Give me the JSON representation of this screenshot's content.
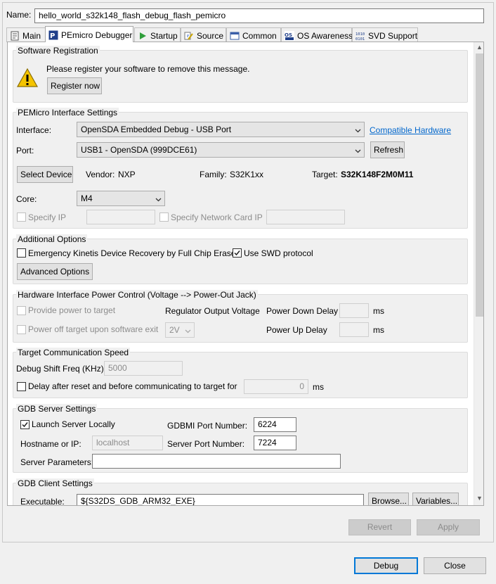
{
  "name_label": "Name:",
  "name_value": "hello_world_s32k148_flash_debug_flash_pemicro",
  "tabs": [
    {
      "label": "Main",
      "icon": "main-tab-icon"
    },
    {
      "label": "PEmicro Debugger",
      "icon": "pemicro-icon"
    },
    {
      "label": "Startup",
      "icon": "play-icon"
    },
    {
      "label": "Source",
      "icon": "source-icon"
    },
    {
      "label": "Common",
      "icon": "common-icon"
    },
    {
      "label": "OS Awareness",
      "icon": "os-icon"
    },
    {
      "label": "SVD Support",
      "icon": "svd-icon"
    }
  ],
  "registration": {
    "title": "Software Registration",
    "message": "Please register your software to remove this message.",
    "register_button": "Register now"
  },
  "interface_settings": {
    "title": "PEMicro Interface Settings",
    "interface_label": "Interface:",
    "interface_value": "OpenSDA Embedded Debug - USB Port",
    "compatible_link": "Compatible Hardware",
    "port_label": "Port:",
    "port_value": "USB1 - OpenSDA (999DCE61)",
    "refresh_button": "Refresh",
    "select_device_button": "Select Device",
    "vendor_label": "Vendor:",
    "vendor_value": "NXP",
    "family_label": "Family:",
    "family_value": "S32K1xx",
    "target_label": "Target:",
    "target_value": "S32K148F2M0M11",
    "core_label": "Core:",
    "core_value": "M4",
    "specify_ip_label": "Specify IP",
    "specify_ip_checked": false,
    "specify_nic_label": "Specify Network Card IP",
    "specify_nic_checked": false
  },
  "additional_options": {
    "title": "Additional Options",
    "emergency_label": "Emergency Kinetis Device Recovery by Full Chip Erase",
    "emergency_checked": false,
    "swd_label": "Use SWD protocol",
    "swd_checked": true,
    "advanced_button": "Advanced Options"
  },
  "power_control": {
    "title": "Hardware Interface Power Control (Voltage --> Power-Out Jack)",
    "provide_power_label": "Provide power to target",
    "provide_power_checked": false,
    "regulator_label": "Regulator Output Voltage",
    "power_down_label": "Power Down Delay",
    "power_down_unit": "ms",
    "power_off_label": "Power off target upon software exit",
    "power_off_checked": false,
    "voltage_value": "2V",
    "power_up_label": "Power Up Delay",
    "power_up_unit": "ms"
  },
  "comm_speed": {
    "title": "Target Communication Speed",
    "shift_freq_label": "Debug Shift Freq (KHz)",
    "shift_freq_value": "5000",
    "delay_label": "Delay after reset and before communicating to target for",
    "delay_checked": false,
    "delay_value": "0",
    "delay_unit": "ms"
  },
  "gdb_server": {
    "title": "GDB Server Settings",
    "launch_label": "Launch Server Locally",
    "launch_checked": true,
    "gdbmi_port_label": "GDBMI Port Number:",
    "gdbmi_port_value": "6224",
    "hostname_label": "Hostname or IP:",
    "hostname_value": "localhost",
    "server_port_label": "Server Port Number:",
    "server_port_value": "7224",
    "params_label": "Server Parameters:",
    "params_value": ""
  },
  "gdb_client": {
    "title": "GDB Client Settings",
    "executable_label": "Executable:",
    "executable_value": "${S32DS_GDB_ARM32_EXE}",
    "browse_button": "Browse...",
    "variables_button": "Variables..."
  },
  "footer": {
    "revert_button": "Revert",
    "apply_button": "Apply",
    "debug_button": "Debug",
    "close_button": "Close"
  },
  "colors": {
    "accent": "#0078d7",
    "link": "#0066cc",
    "warning": "#f5c400"
  }
}
